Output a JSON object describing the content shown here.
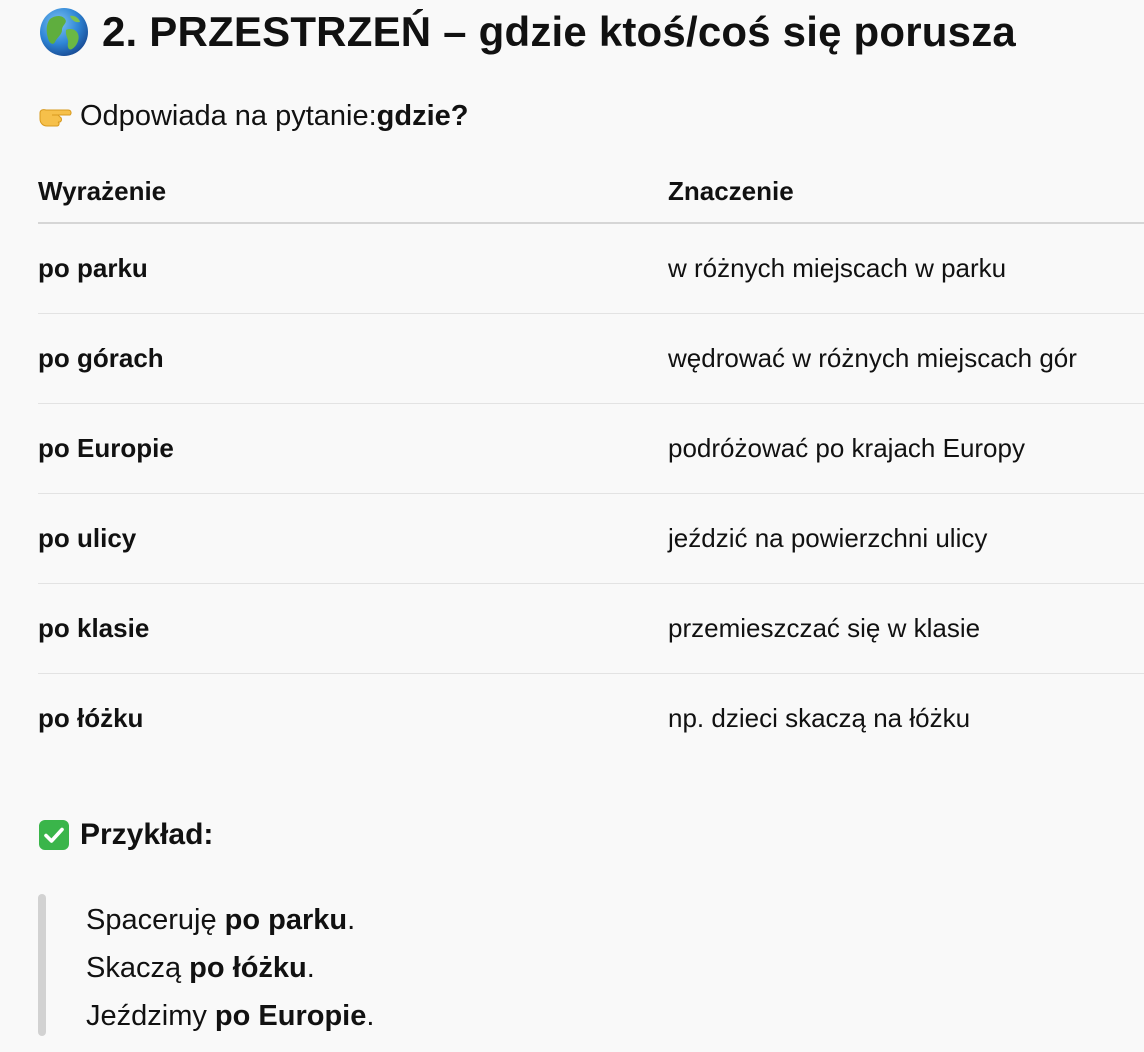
{
  "heading": {
    "icon": "globe-icon",
    "text": "2. PRZESTRZEŃ – gdzie ktoś/coś się porusza"
  },
  "intro": {
    "icon": "pointing-hand-icon",
    "text": "Odpowiada na pytanie: ",
    "bold": "gdzie?"
  },
  "table": {
    "headers": [
      "Wyrażenie",
      "Znaczenie"
    ],
    "rows": [
      [
        "po parku",
        "w różnych miejscach w parku"
      ],
      [
        "po górach",
        "wędrować w różnych miejscach gór"
      ],
      [
        "po Europie",
        "podróżować po krajach Europy"
      ],
      [
        "po ulicy",
        "jeździć na powierzchni ulicy"
      ],
      [
        "po klasie",
        "przemieszczać się w klasie"
      ],
      [
        "po łóżku",
        "np. dzieci skaczą na łóżku"
      ]
    ]
  },
  "example": {
    "icon": "check-mark-icon",
    "label": "Przykład:",
    "lines": [
      {
        "before": "Spaceruję ",
        "bold": "po parku",
        "after": "."
      },
      {
        "before": "Skaczą ",
        "bold": "po łóżku",
        "after": "."
      },
      {
        "before": "Jeździmy ",
        "bold": "po Europie",
        "after": "."
      }
    ]
  },
  "colors": {
    "background": "#f9f9f9",
    "text": "#111111",
    "check_green": "#3ab54a",
    "quote_bar": "#d2d2d2"
  }
}
